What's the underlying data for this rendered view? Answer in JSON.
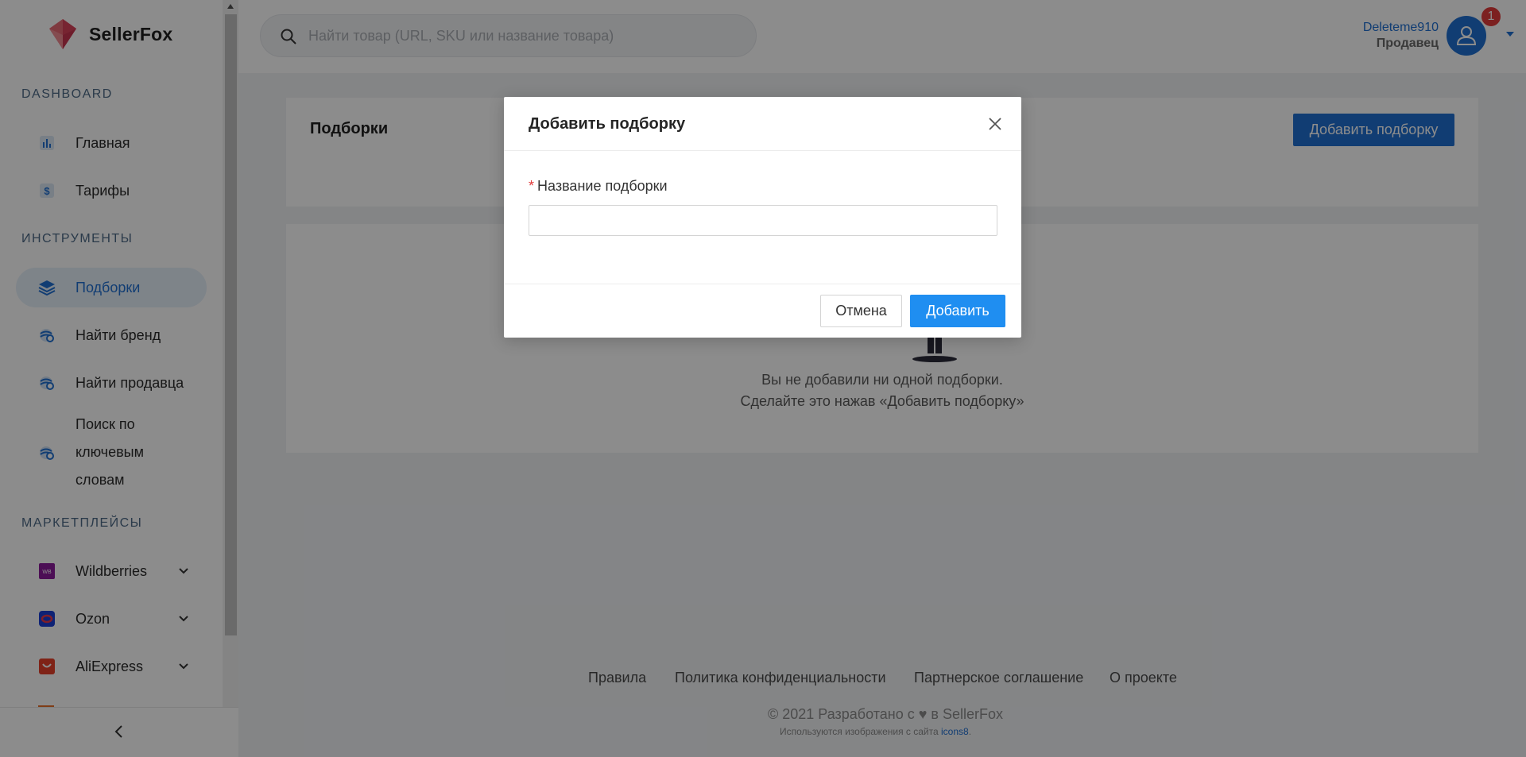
{
  "brand": {
    "name": "SellerFox",
    "accent": "#1f6fd1",
    "logo_color": "#e0475a"
  },
  "sidebar": {
    "sections": [
      {
        "title": "DASHBOARD"
      },
      {
        "title": "ИНСТРУМЕНТЫ"
      },
      {
        "title": "МАРКЕТПЛЕЙСЫ"
      }
    ],
    "items": [
      {
        "label": "Главная",
        "icon": "bar-chart-icon"
      },
      {
        "label": "Тарифы",
        "icon": "dollar-icon"
      },
      {
        "label": "Подборки",
        "icon": "layers-icon",
        "active": true
      },
      {
        "label": "Найти бренд",
        "icon": "globe-search-icon"
      },
      {
        "label": "Найти продавца",
        "icon": "globe-search-icon"
      },
      {
        "label_lines": [
          "Поиск по",
          "ключевым",
          "словам"
        ],
        "icon": "globe-search-icon"
      },
      {
        "label": "Wildberries",
        "icon": "wildberries-icon",
        "expandable": true
      },
      {
        "label": "Ozon",
        "icon": "ozon-icon",
        "expandable": true
      },
      {
        "label": "AliExpress",
        "icon": "aliexpress-icon",
        "expandable": true
      }
    ]
  },
  "header": {
    "search_placeholder": "Найти товар (URL, SKU или название товара)",
    "user_name": "Deleteme910",
    "user_role": "Продавец",
    "notification_count": "1"
  },
  "page": {
    "title": "Подборки",
    "add_button": "Добавить подборку",
    "empty_line1": "Вы не добавили ни одной подборки.",
    "empty_line2": "Сделайте это нажав «Добавить подборку»"
  },
  "footer": {
    "links": [
      "Правила",
      "Политика конфиденциальности",
      "Партнерское соглашение",
      "О проекте"
    ],
    "copyright": "© 2021 Разработано с ♥ в SellerFox",
    "credit_prefix": "Используются изображения с сайта ",
    "credit_link": "icons8",
    "credit_suffix": "."
  },
  "modal": {
    "title": "Добавить подборку",
    "field_label": "Название подборки",
    "field_value": "",
    "cancel": "Отмена",
    "submit": "Добавить"
  }
}
